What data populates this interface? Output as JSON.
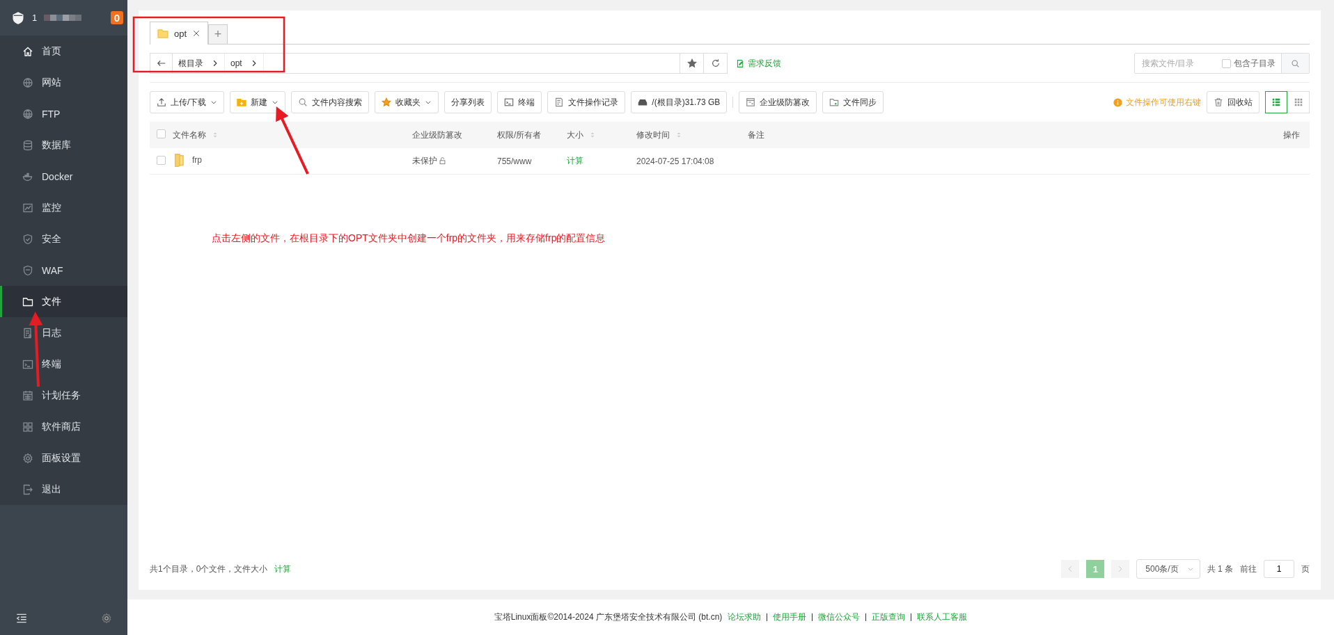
{
  "sidebar": {
    "host_name": "1",
    "badge": "0",
    "items": [
      {
        "label": "首页",
        "selected": false,
        "accent": true
      },
      {
        "label": "网站",
        "selected": false,
        "accent": false
      },
      {
        "label": "FTP",
        "selected": false,
        "accent": false
      },
      {
        "label": "数据库",
        "selected": false,
        "accent": false
      },
      {
        "label": "Docker",
        "selected": false,
        "accent": false
      },
      {
        "label": "监控",
        "selected": false,
        "accent": false
      },
      {
        "label": "安全",
        "selected": false,
        "accent": false
      },
      {
        "label": "WAF",
        "selected": false,
        "accent": false
      },
      {
        "label": "文件",
        "selected": true,
        "accent": true
      },
      {
        "label": "日志",
        "selected": false,
        "accent": false
      },
      {
        "label": "终端",
        "selected": false,
        "accent": false
      },
      {
        "label": "计划任务",
        "selected": false,
        "accent": false
      },
      {
        "label": "软件商店",
        "selected": false,
        "accent": false
      },
      {
        "label": "面板设置",
        "selected": false,
        "accent": false
      },
      {
        "label": "退出",
        "selected": false,
        "accent": false
      }
    ]
  },
  "tabs": [
    {
      "label": "opt",
      "selected": true
    }
  ],
  "add_tab": "+",
  "breadcrumb": [
    "根目录",
    "opt"
  ],
  "feedback_link": "需求反馈",
  "search": {
    "placeholder": "搜索文件/目录",
    "include_subdirs": {
      "label": "包含子目录",
      "checked": false
    }
  },
  "toolbar": [
    {
      "label": "上传/下载",
      "dropdown": true
    },
    {
      "label": "新建",
      "dropdown": true
    },
    {
      "label": "文件内容搜索",
      "dropdown": false
    },
    {
      "label": "收藏夹",
      "dropdown": true
    },
    {
      "label": "分享列表",
      "dropdown": false
    },
    {
      "label": "终端",
      "dropdown": false
    },
    {
      "label": "文件操作记录",
      "dropdown": false
    },
    {
      "label": "/(根目录)31.73 GB",
      "dropdown": false
    },
    {
      "label": "企业级防篡改",
      "dropdown": false
    },
    {
      "label": "文件同步",
      "dropdown": false
    }
  ],
  "tip": "文件操作可使用右键",
  "recycle_bin": "回收站",
  "views": [
    {
      "kind": "list",
      "selected": true
    },
    {
      "kind": "grid",
      "selected": false
    }
  ],
  "table": {
    "select_all_checked": false,
    "columns": [
      {
        "label": "文件名称",
        "sortable": true
      },
      {
        "label": "企业级防篡改",
        "sortable": false
      },
      {
        "label": "权限/所有者",
        "sortable": false
      },
      {
        "label": "大小",
        "sortable": true
      },
      {
        "label": "修改时间",
        "sortable": true
      },
      {
        "label": "备注",
        "sortable": false
      },
      {
        "label": "操作",
        "sortable": false
      }
    ],
    "rows": [
      {
        "name": "frp",
        "protection": "未保护",
        "permission": "755/www",
        "size": "计算",
        "modified": "2024-07-25 17:04:08",
        "checked": false
      }
    ]
  },
  "summary": {
    "text": "共1个目录，0个文件，文件大小",
    "link": "计算"
  },
  "pagination": {
    "pages": [
      {
        "label": "1",
        "selected": true
      }
    ],
    "page_size": "500条/页",
    "total": "共 1 条",
    "goto_label": "前往",
    "goto_value": "1",
    "page_unit": "页"
  },
  "footer": {
    "copyright": "宝塔Linux面板©2014-2024 广东堡塔安全技术有限公司 (bt.cn)",
    "links": [
      "论坛求助",
      "使用手册",
      "微信公众号",
      "正版查询",
      "联系人工客服"
    ]
  },
  "annotation": {
    "text": "点击左侧的文件，在根目录下的OPT文件夹中创建一个frp的文件夹，用来存储frp的配置信息"
  }
}
